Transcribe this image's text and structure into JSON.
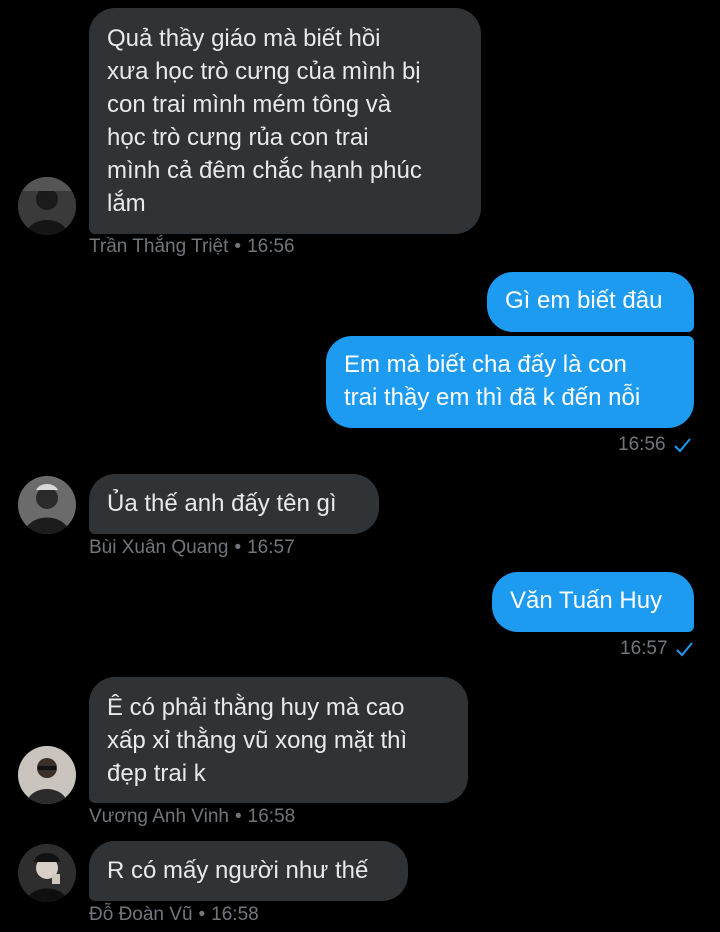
{
  "colors": {
    "background": "#000000",
    "incoming_bubble": "#2f3336",
    "outgoing_bubble": "#1d9bf0",
    "meta_text": "#71767b",
    "read_check": "#1d9bf0"
  },
  "messages": [
    {
      "direction": "incoming",
      "text": "Quả thầy giáo mà biết hồi\nxưa học trò cưng của mình bị\ncon trai mình mém tông và\nhọc trò cưng rủa con trai\nmình cả đêm chắc hạnh phúc\nlắm",
      "sender": "Trần Thắng Triệt",
      "time": "16:56",
      "avatar_icon": "avatar-icon"
    },
    {
      "direction": "outgoing",
      "text": "Gì em biết đâu"
    },
    {
      "direction": "outgoing",
      "text": "Em mà biết cha đấy là con\ntrai thầy em thì đã k đến nỗi",
      "time": "16:56",
      "status_icon": "read-check-icon"
    },
    {
      "direction": "incoming",
      "text": "Ủa thế anh đấy tên gì",
      "sender": "Bùi Xuân Quang",
      "time": "16:57",
      "avatar_icon": "avatar-icon"
    },
    {
      "direction": "outgoing",
      "text": "Văn Tuấn Huy",
      "time": "16:57",
      "status_icon": "read-check-icon"
    },
    {
      "direction": "incoming",
      "text": "Ê có phải thằng huy mà cao\nxấp xỉ thằng vũ xong mặt thì\nđẹp trai k",
      "sender": "Vương Anh Vinh",
      "time": "16:58",
      "avatar_icon": "avatar-icon"
    },
    {
      "direction": "incoming",
      "text": "R có mấy người như thế",
      "sender": "Đỗ Đoàn Vũ",
      "time": "16:58",
      "avatar_icon": "avatar-icon"
    }
  ],
  "separator": "•"
}
